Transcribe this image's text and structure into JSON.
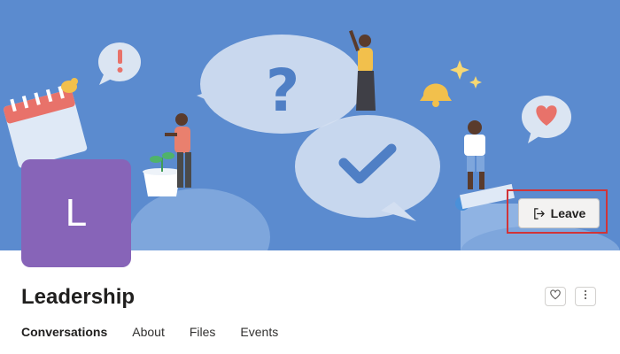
{
  "group": {
    "avatar_letter": "L",
    "name": "Leadership",
    "avatar_color": "#8764b8"
  },
  "banner": {
    "background_color": "#5b8bcf"
  },
  "actions": {
    "leave_label": "Leave",
    "leave_icon": "sign-out-icon",
    "follow_icon": "heart-icon",
    "more_icon": "more-vertical-icon"
  },
  "tabs": [
    {
      "label": "Conversations",
      "active": true
    },
    {
      "label": "About",
      "active": false
    },
    {
      "label": "Files",
      "active": false
    },
    {
      "label": "Events",
      "active": false
    }
  ]
}
